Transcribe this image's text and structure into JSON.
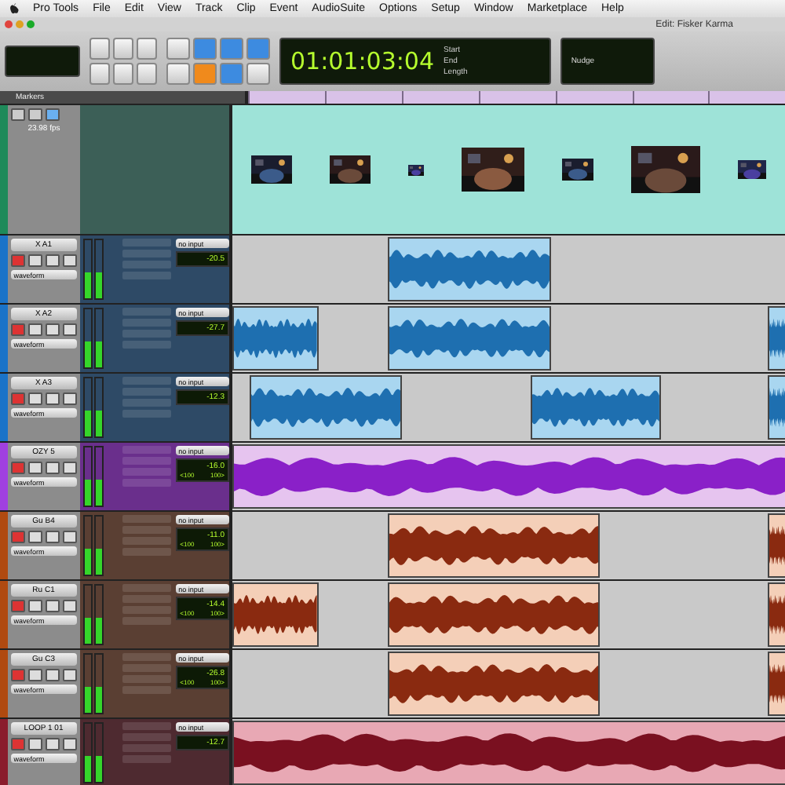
{
  "menu_bar": {
    "items": [
      "Pro Tools",
      "File",
      "Edit",
      "View",
      "Track",
      "Clip",
      "Event",
      "AudioSuite",
      "Options",
      "Setup",
      "Window",
      "Marketplace",
      "Help"
    ]
  },
  "window": {
    "title": "Edit: Fisker Karma"
  },
  "transport": {
    "main_counter": "01:01:03:04",
    "selection_labels": [
      "Start",
      "End",
      "Length"
    ],
    "nudge_label": "Nudge"
  },
  "rulers": {
    "markers_label": "Markers"
  },
  "tracks": [
    {
      "kind": "video",
      "color": "#1e8a5a",
      "rate": "23.98 fps"
    },
    {
      "kind": "audio",
      "name": "X A1",
      "color": "#1a73c8",
      "view": "waveform",
      "input": "no input",
      "volume": "-20.5"
    },
    {
      "kind": "audio",
      "name": "X A2",
      "color": "#1a73c8",
      "view": "waveform",
      "input": "no input",
      "volume": "-27.7"
    },
    {
      "kind": "audio",
      "name": "X A3",
      "color": "#1a73c8",
      "view": "waveform",
      "input": "no input",
      "volume": "-12.3"
    },
    {
      "kind": "audio",
      "name": "OZY 5",
      "color": "#a040e0",
      "view": "waveform",
      "input": "no input",
      "volume": "-16.0",
      "pan_left": "<100",
      "pan_right": "100>"
    },
    {
      "kind": "audio",
      "name": "Gu B4",
      "color": "#b04a10",
      "view": "waveform",
      "input": "no input",
      "volume": "-11.0",
      "pan_left": "<100",
      "pan_right": "100>"
    },
    {
      "kind": "audio",
      "name": "Ru C1",
      "color": "#b04a10",
      "view": "waveform",
      "input": "no input",
      "volume": "-14.4",
      "pan_left": "<100",
      "pan_right": "100>"
    },
    {
      "kind": "audio",
      "name": "Gu C3",
      "color": "#b04a10",
      "view": "waveform",
      "input": "no input",
      "volume": "-26.8",
      "pan_left": "<100",
      "pan_right": "100>"
    },
    {
      "kind": "audio",
      "name": "LOOP 1 01",
      "color": "#8a1c2c",
      "view": "waveform",
      "input": "no input",
      "volume": "-12.7"
    }
  ]
}
